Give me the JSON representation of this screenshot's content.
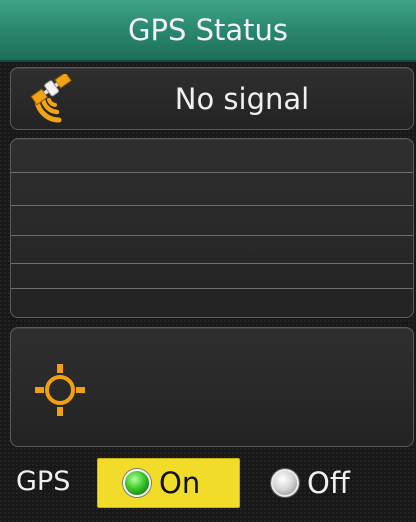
{
  "title_bar": {
    "title": "GPS Status"
  },
  "signal": {
    "status_text": "No signal",
    "icon": "satellite-dish-icon"
  },
  "satellite_list": {
    "rows": 6,
    "items": []
  },
  "locate": {
    "icon": "crosshair-locate-icon"
  },
  "gps_toggle": {
    "label": "GPS",
    "options": [
      {
        "label": "On",
        "selected": true
      },
      {
        "label": "Off",
        "selected": false
      }
    ]
  },
  "colors": {
    "title_bar": "#2b8a70",
    "accent_orange": "#f0a010",
    "selected_highlight": "#f2dc2a",
    "radio_on": "#38c82a"
  }
}
